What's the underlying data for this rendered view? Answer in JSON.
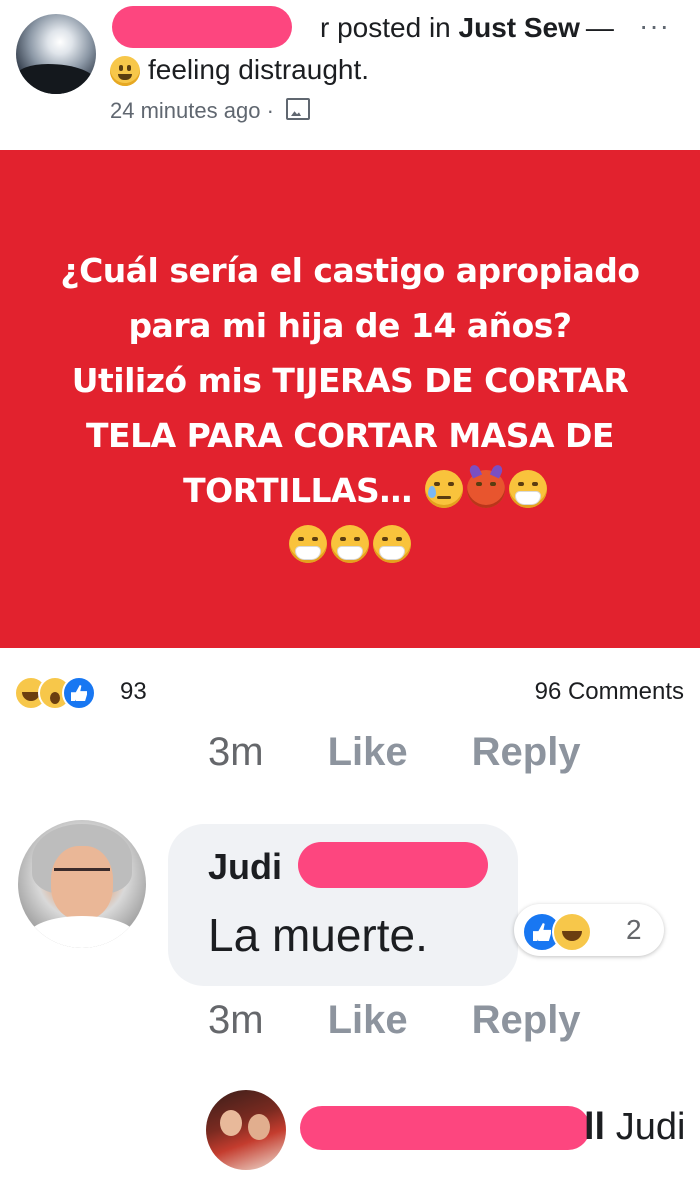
{
  "post": {
    "author_suffix": "r",
    "posted_in": "posted in",
    "group": "Just Sew",
    "dash": "—",
    "more": "···",
    "feeling": "feeling distraught.",
    "time": "24 minutes ago",
    "separator": "·"
  },
  "banner": {
    "lines": [
      "¿Cuál sería el castigo apropiado",
      "para mi hija de 14 años?",
      "Utilizó mis TIJERAS DE CORTAR",
      "TELA PARA CORTAR MASA DE",
      "TORTILLAS…"
    ],
    "background": "#e2222e"
  },
  "summary": {
    "reaction_count": "93",
    "comments": "96 Comments"
  },
  "comment_actions_top": {
    "time": "3m",
    "like": "Like",
    "reply": "Reply"
  },
  "comment": {
    "author": "Judi",
    "text": "La muerte.",
    "reaction_count": "2"
  },
  "comment_actions_bottom": {
    "time": "3m",
    "like": "Like",
    "reply": "Reply"
  },
  "reply_preview": {
    "name_fragment": "ll",
    "name": "Judi"
  }
}
